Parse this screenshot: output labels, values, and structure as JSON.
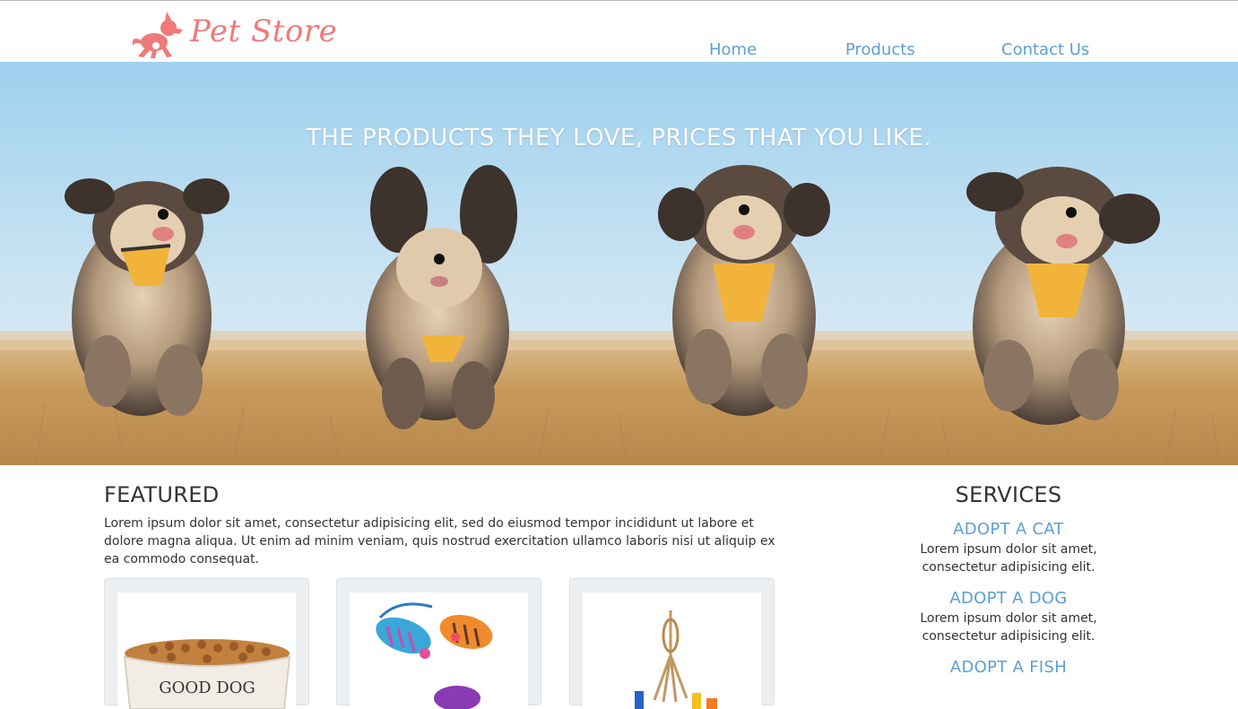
{
  "brand": {
    "name": "Pet Store",
    "color": "#ef7a78"
  },
  "nav": {
    "items": [
      {
        "label": "Home"
      },
      {
        "label": "Products"
      },
      {
        "label": "Contact Us"
      }
    ],
    "color": "#5b9fd6"
  },
  "hero": {
    "tagline": "THE PRODUCTS THEY LOVE, PRICES THAT YOU LIKE."
  },
  "featured": {
    "title": "FEATURED",
    "body": "Lorem ipsum dolor sit amet, consectetur adipisicing elit, sed do eiusmod tempor incididunt ut labore et dolore magna aliqua. Ut enim ad minim veniam, quis nostrud exercitation ullamco laboris nisi ut aliquip ex ea commodo consequat.",
    "products": [
      {
        "image": "dog-food-bowl",
        "bowl_text": "GOOD DOG"
      },
      {
        "image": "cat-toy-mice"
      },
      {
        "image": "bird-rope-toy"
      }
    ]
  },
  "services": {
    "title": "SERVICES",
    "items": [
      {
        "title": "ADOPT A CAT",
        "body": "Lorem ipsum dolor sit amet, consectetur adipisicing elit."
      },
      {
        "title": "ADOPT A DOG",
        "body": "Lorem ipsum dolor sit amet, consectetur adipisicing elit."
      },
      {
        "title": "ADOPT A FISH",
        "body": ""
      }
    ]
  }
}
